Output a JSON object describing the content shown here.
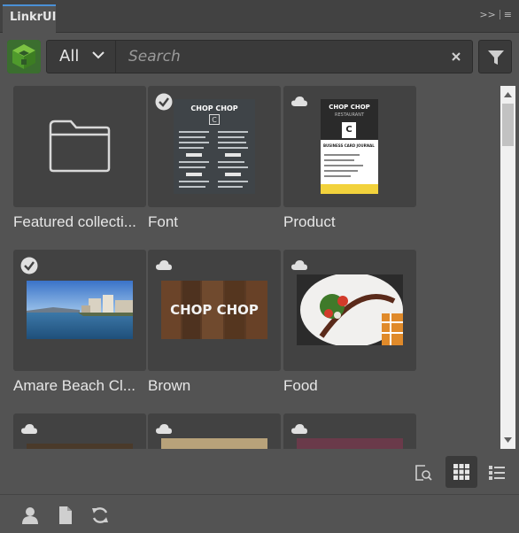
{
  "tab": {
    "title": "LinkrUI"
  },
  "toolbar": {
    "filter_value": "All",
    "search_placeholder": "Search"
  },
  "grid": {
    "items": [
      {
        "label": "Featured collecti...",
        "badge": "none",
        "kind": "folder"
      },
      {
        "label": "Font",
        "badge": "check",
        "kind": "menu"
      },
      {
        "label": "Product",
        "badge": "cloud",
        "kind": "card"
      },
      {
        "label": "Amare Beach Cl...",
        "badge": "check",
        "kind": "beach"
      },
      {
        "label": "Brown",
        "badge": "cloud",
        "kind": "wood"
      },
      {
        "label": "Food",
        "badge": "cloud",
        "kind": "food"
      },
      {
        "label": "",
        "badge": "cloud",
        "kind": "partial"
      },
      {
        "label": "",
        "badge": "cloud",
        "kind": "partial"
      },
      {
        "label": "",
        "badge": "cloud",
        "kind": "partial"
      }
    ],
    "thumb_text": {
      "brand": "CHOP CHOP",
      "brand_sub": "RESTAURANT",
      "monogram": "C",
      "card_title": "BUSINESS CARD JOURNAL"
    }
  },
  "icons": {
    "logo": "cube-logo-icon",
    "filter": "funnel-icon",
    "preview": "preview-search-icon",
    "grid_view": "grid-view-icon",
    "list_view": "list-view-icon",
    "user": "user-icon",
    "document": "document-icon",
    "refresh": "refresh-icon"
  },
  "colors": {
    "panel_bg": "#535353",
    "card_bg": "#424242",
    "accent_tab": "#4a90d6",
    "logo_green": "#5aa83a"
  }
}
